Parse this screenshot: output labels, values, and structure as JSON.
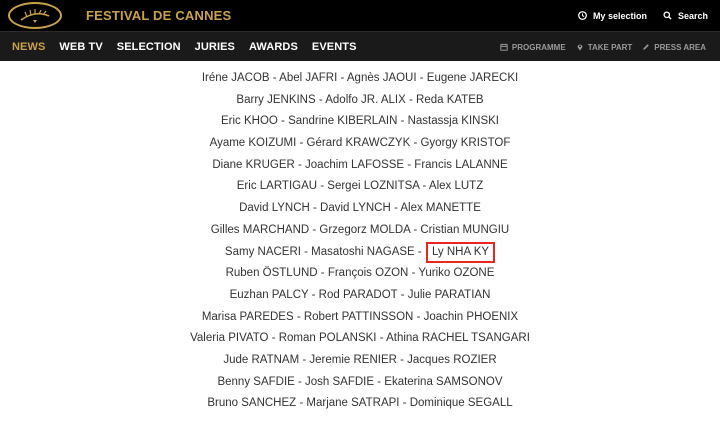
{
  "header": {
    "brand": "FESTIVAL DE CANNES",
    "my_selection": "My selection",
    "search": "Search",
    "accent_color": "#c9a24b"
  },
  "nav": {
    "items": [
      "NEWS",
      "WEB TV",
      "SELECTION",
      "JURIES",
      "AWARDS",
      "EVENTS"
    ],
    "active": "NEWS",
    "secondary": [
      {
        "label": "PROGRAMME",
        "icon": "calendar-icon"
      },
      {
        "label": "TAKE PART",
        "icon": "location-pin-icon"
      },
      {
        "label": "PRESS AREA",
        "icon": "pencil-icon"
      }
    ]
  },
  "jury": {
    "lines": [
      "Iréne JACOB - Abel JAFRI - Agnès JAOUI - Eugene JARECKI",
      "Barry JENKINS - Adolfo JR. ALIX - Reda KATEB",
      "Eric KHOO - Sandrine KIBERLAIN - Nastassja KINSKI",
      "Ayame KOIZUMI - Gérard KRAWCZYK - Gyorgy KRISTOF",
      "Diane KRUGER - Joachim LAFOSSE - Francis LALANNE",
      "Eric LARTIGAU - Sergei LOZNITSA - Alex LUTZ",
      "David LYNCH - David LYNCH - Alex MANETTE",
      "Gilles MARCHAND - Grzegorz MOLDA - Cristian MUNGIU",
      "Samy NACERI - Masatoshi NAGASE - ",
      "Ruben ÖSTLUND - François OZON - Yuriko OZONE",
      "Euzhan PALCY - Rod PARADOT - Julie PARATIAN",
      "Marisa PAREDES - Robert PATTINSSON - Joachin PHOENIX",
      "Valeria PIVATO - Roman POLANSKI - Athina RACHEL TSANGARI",
      "Jude RATNAM - Jeremie RENIER - Jacques ROZIER",
      "Benny SAFDIE - Josh SAFDIE - Ekaterina SAMSONOV",
      "Bruno SANCHEZ - Marjane SATRAPI - Dominique SEGALL"
    ],
    "highlighted_name": "Ly NHA KY",
    "highlight_color": "#e8271f"
  }
}
